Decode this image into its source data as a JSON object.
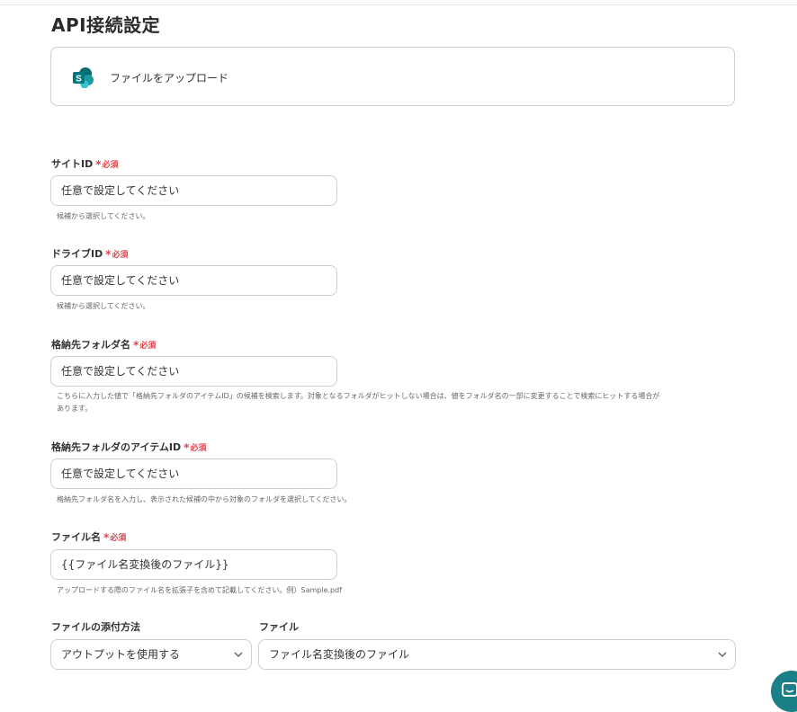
{
  "page": {
    "title": "API接続設定"
  },
  "app": {
    "action_label": "ファイルをアップロード",
    "icon": "sharepoint-icon"
  },
  "required_label": "必須",
  "fields": {
    "site_id": {
      "label": "サイトID",
      "value": "任意で設定してください",
      "help": "候補から選択してください。"
    },
    "drive_id": {
      "label": "ドライブID",
      "value": "任意で設定してください",
      "help": "候補から選択してください。"
    },
    "folder_name": {
      "label": "格納先フォルダ名",
      "value": "任意で設定してください",
      "help_line1": "こちらに入力した値で「格納先フォルダのアイテムID」の候補を検索します。対象となるフォルダがヒットしない場合は、値をフォルダ名の一部に変更することで検索にヒットする場合が",
      "help_line2": "あります。"
    },
    "folder_item_id": {
      "label": "格納先フォルダのアイテムID",
      "value": "任意で設定してください",
      "help": "格納先フォルダ名を入力し、表示された候補の中から対象のフォルダを選択してください。"
    },
    "file_name": {
      "label": "ファイル名",
      "value": "{{ファイル名変換後のファイル}}",
      "help": "アップロードする際のファイル名を拡張子を含めて記載してください。例）Sample.pdf"
    },
    "attach_method": {
      "label": "ファイルの添付方法",
      "selected": "アウトプットを使用する"
    },
    "file": {
      "label": "ファイル",
      "selected": "ファイル名変換後のファイル"
    }
  },
  "colors": {
    "required": "#e0424b",
    "accent": "#1a7f86",
    "border": "#cfcfcf"
  }
}
